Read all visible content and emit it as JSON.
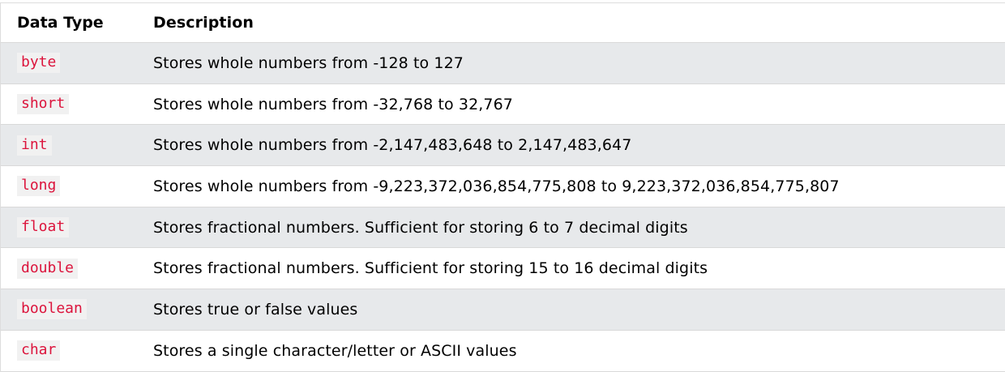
{
  "table": {
    "headers": {
      "type": "Data Type",
      "description": "Description"
    },
    "rows": [
      {
        "type": "byte",
        "description": "Stores whole numbers from -128 to 127"
      },
      {
        "type": "short",
        "description": "Stores whole numbers from -32,768 to 32,767"
      },
      {
        "type": "int",
        "description": "Stores whole numbers from -2,147,483,648 to 2,147,483,647"
      },
      {
        "type": "long",
        "description": "Stores whole numbers from -9,223,372,036,854,775,808 to 9,223,372,036,854,775,807"
      },
      {
        "type": "float",
        "description": "Stores fractional numbers. Sufficient for storing 6 to 7 decimal digits"
      },
      {
        "type": "double",
        "description": "Stores fractional numbers. Sufficient for storing 15 to 16 decimal digits"
      },
      {
        "type": "boolean",
        "description": "Stores true or false values"
      },
      {
        "type": "char",
        "description": "Stores a single character/letter or ASCII values"
      }
    ],
    "colors": {
      "code_text": "#dc143c",
      "code_background": "#f1f1f1",
      "striped_row": "#e7e9eb"
    }
  }
}
